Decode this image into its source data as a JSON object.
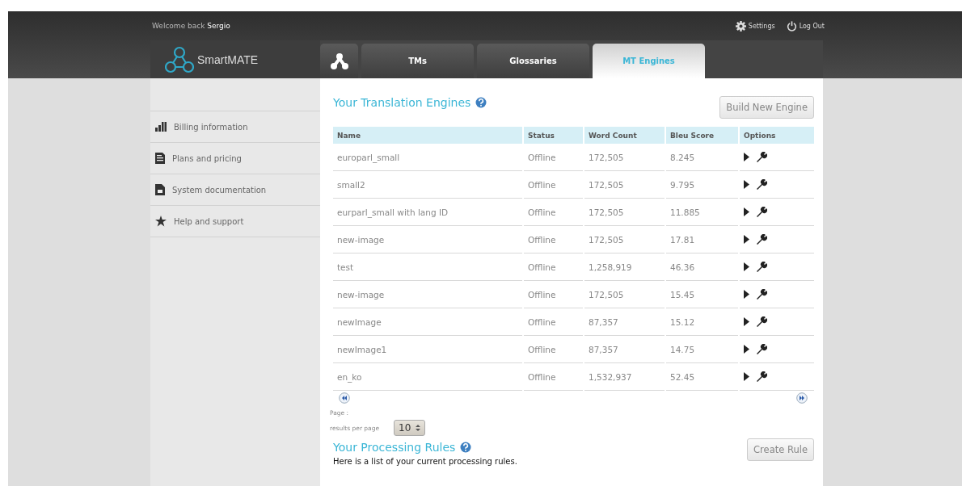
{
  "header": {
    "welcome": "Welcome back",
    "user": "Sergio",
    "links": [
      {
        "kind": "settings",
        "label": "Settings"
      },
      {
        "kind": "logout",
        "label": "Log Out"
      }
    ]
  },
  "brand": "SmartMATE",
  "tabs": [
    {
      "kind": "icon",
      "selected": false
    },
    {
      "label": "TMs",
      "selected": false
    },
    {
      "label": "Glossaries",
      "selected": false
    },
    {
      "label": "MT Engines",
      "selected": true
    }
  ],
  "sidebar": {
    "items": [
      {
        "kind": "chart",
        "label": "Billing information"
      },
      {
        "kind": "doc",
        "label": "Plans and pricing"
      },
      {
        "kind": "file",
        "label": "System documentation"
      },
      {
        "kind": "star",
        "label": "Help and support"
      }
    ]
  },
  "engines": {
    "title": "Your Translation Engines",
    "button": "Build New Engine",
    "columns": [
      "Name",
      "Status",
      "Word Count",
      "Bleu Score",
      "Options"
    ],
    "rows": [
      [
        "europarl_small",
        "Offline",
        "172,505",
        "8.245"
      ],
      [
        "small2",
        "Offline",
        "172,505",
        "9.795"
      ],
      [
        "eurparl_small with lang ID",
        "Offline",
        "172,505",
        "11.885"
      ],
      [
        "new-image",
        "Offline",
        "172,505",
        "17.81"
      ],
      [
        "test",
        "Offline",
        "1,258,919",
        "46.36"
      ],
      [
        "new-image",
        "Offline",
        "172,505",
        "15.45"
      ],
      [
        "newImage",
        "Offline",
        "87,357",
        "15.12"
      ],
      [
        "newImage1",
        "Offline",
        "87,357",
        "14.75"
      ],
      [
        "en_ko",
        "Offline",
        "1,532,937",
        "52.45"
      ]
    ],
    "page_label": "Page :",
    "per_page_label": "results per page",
    "per_page": "10"
  },
  "rules": {
    "title": "Your Processing Rules",
    "button": "Create Rule",
    "text": "Here is a list of your current processing rules."
  }
}
